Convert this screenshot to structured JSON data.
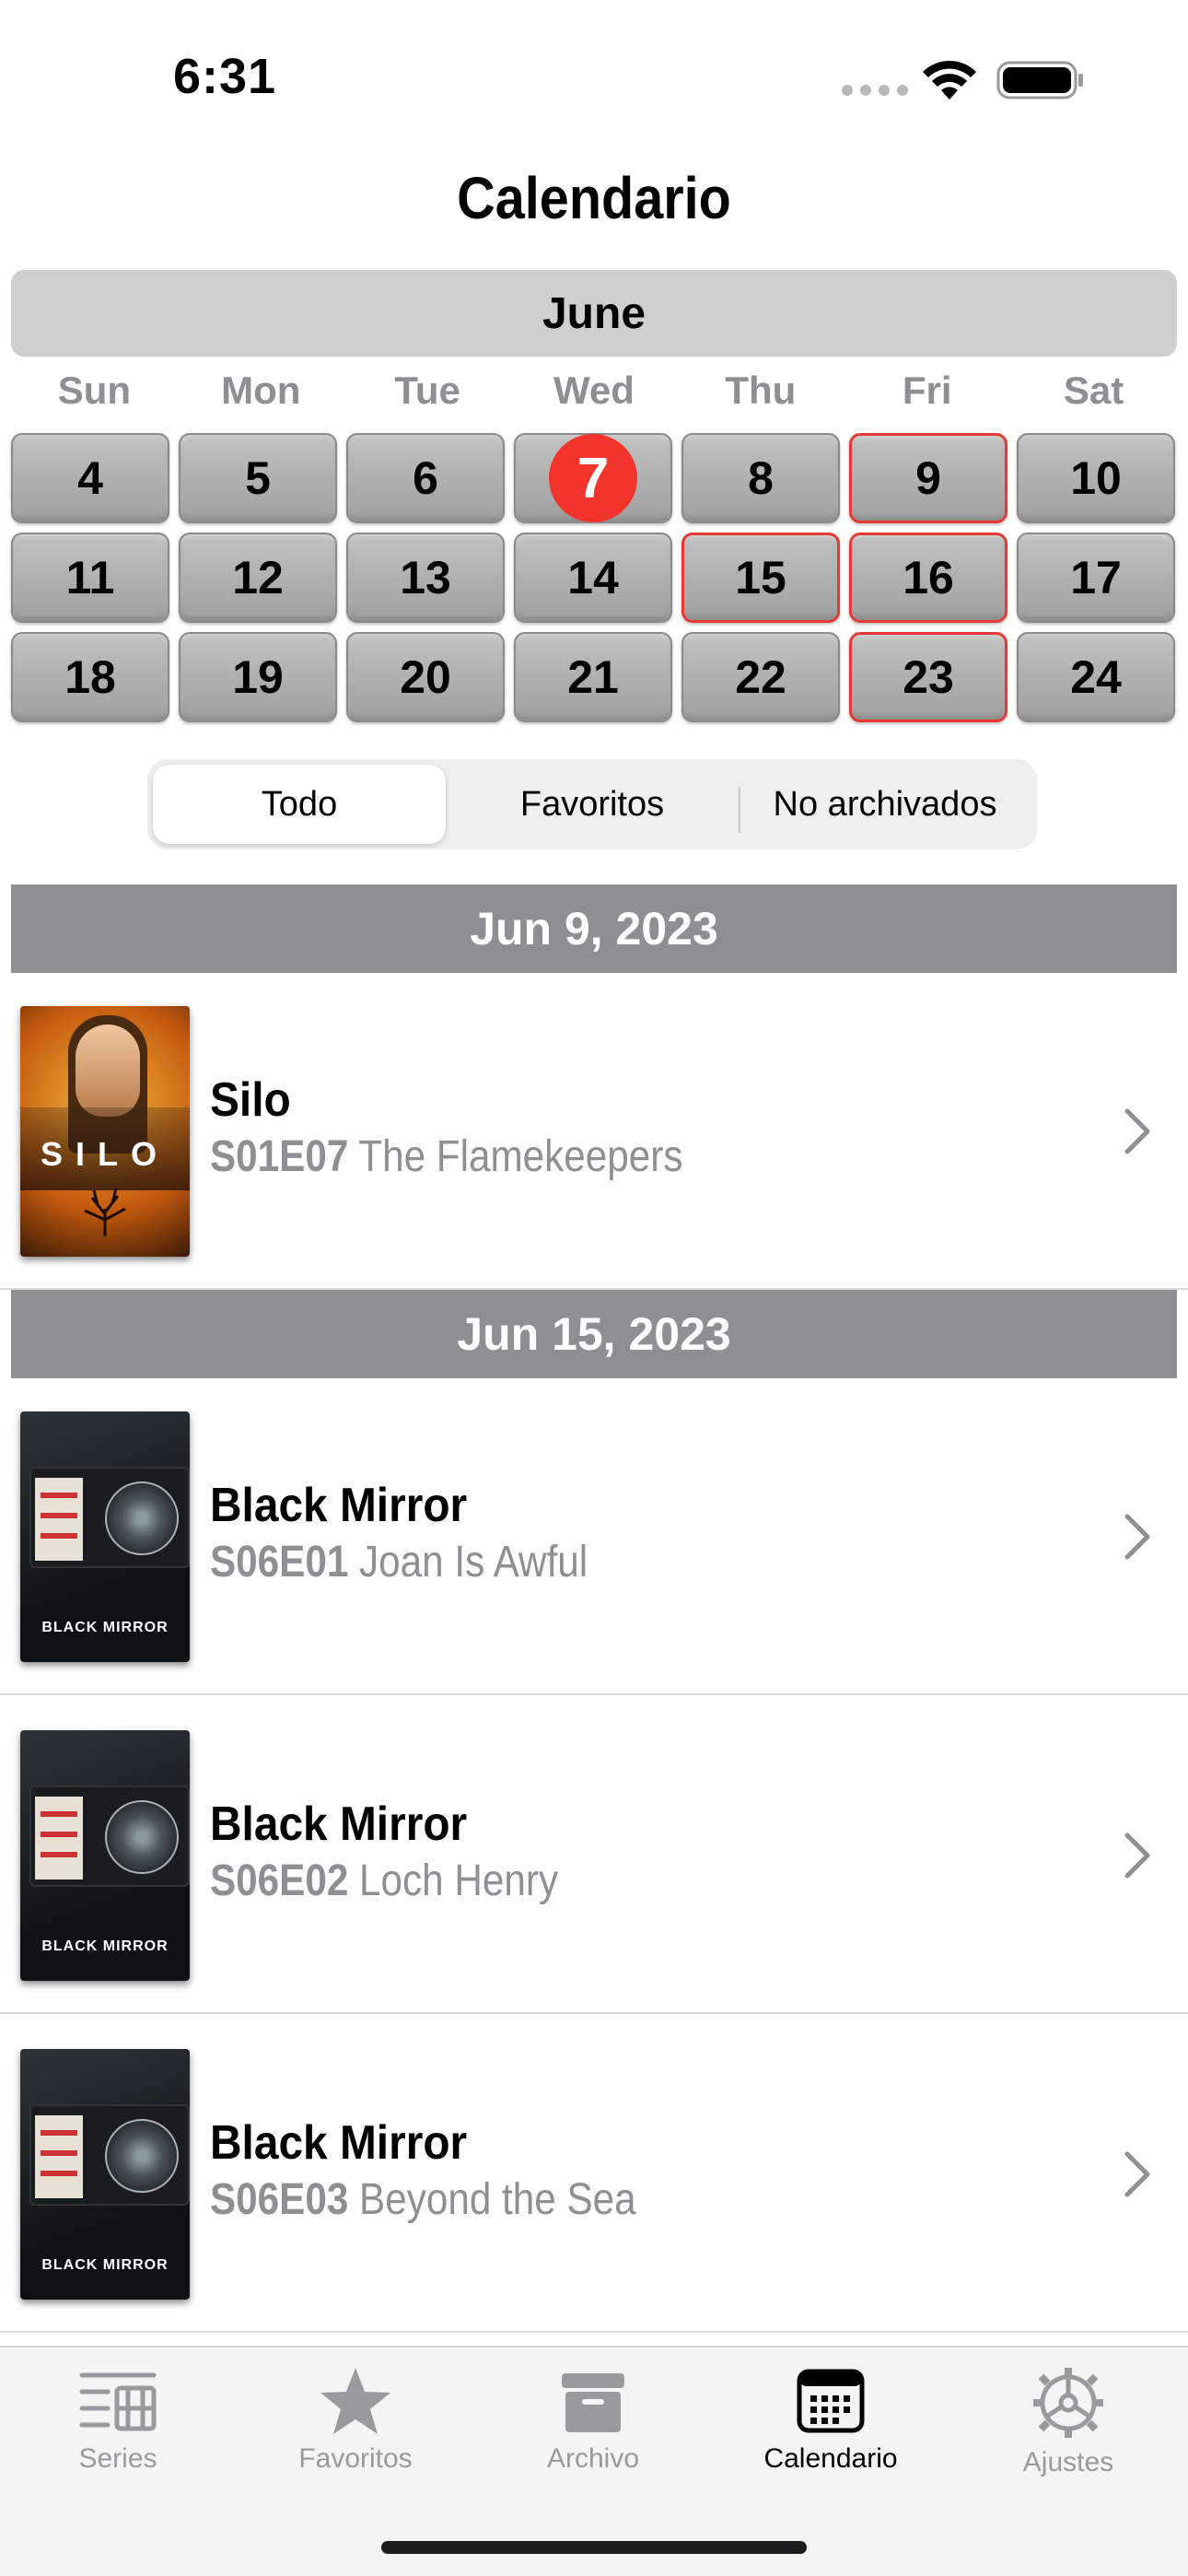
{
  "status_bar": {
    "time": "6:31"
  },
  "page_title": "Calendario",
  "calendar": {
    "month": "June",
    "weekdays": [
      "Sun",
      "Mon",
      "Tue",
      "Wed",
      "Thu",
      "Fri",
      "Sat"
    ],
    "weeks": [
      [
        {
          "day": "4"
        },
        {
          "day": "5"
        },
        {
          "day": "6"
        },
        {
          "day": "7",
          "today": true
        },
        {
          "day": "8"
        },
        {
          "day": "9",
          "marked": true
        },
        {
          "day": "10"
        }
      ],
      [
        {
          "day": "11"
        },
        {
          "day": "12"
        },
        {
          "day": "13"
        },
        {
          "day": "14"
        },
        {
          "day": "15",
          "marked": true
        },
        {
          "day": "16",
          "marked": true
        },
        {
          "day": "17"
        }
      ],
      [
        {
          "day": "18"
        },
        {
          "day": "19"
        },
        {
          "day": "20"
        },
        {
          "day": "21"
        },
        {
          "day": "22"
        },
        {
          "day": "23",
          "marked": true
        },
        {
          "day": "24"
        }
      ]
    ],
    "marked_color": "#e53935",
    "today_color": "#f2342c"
  },
  "filter": {
    "options": [
      "Todo",
      "Favoritos",
      "No archivados"
    ],
    "selected": "Todo"
  },
  "sections": [
    {
      "date": "Jun 9, 2023",
      "episodes": [
        {
          "show": "Silo",
          "code": "S01E07",
          "title": "The Flamekeepers",
          "poster": "silo",
          "poster_text": "SILO"
        }
      ]
    },
    {
      "date": "Jun 15, 2023",
      "episodes": [
        {
          "show": "Black Mirror",
          "code": "S06E01",
          "title": "Joan Is Awful",
          "poster": "black-mirror",
          "poster_text": "BLACK MIRROR"
        },
        {
          "show": "Black Mirror",
          "code": "S06E02",
          "title": "Loch Henry",
          "poster": "black-mirror",
          "poster_text": "BLACK MIRROR"
        },
        {
          "show": "Black Mirror",
          "code": "S06E03",
          "title": "Beyond the Sea",
          "poster": "black-mirror",
          "poster_text": "BLACK MIRROR"
        }
      ]
    }
  ],
  "tabbar": {
    "items": [
      {
        "label": "Series",
        "icon": "series-icon",
        "active": false
      },
      {
        "label": "Favoritos",
        "icon": "star-icon",
        "active": false
      },
      {
        "label": "Archivo",
        "icon": "archive-box-icon",
        "active": false
      },
      {
        "label": "Calendario",
        "icon": "calendar-icon",
        "active": true
      },
      {
        "label": "Ajustes",
        "icon": "gear-icon",
        "active": false
      }
    ]
  }
}
